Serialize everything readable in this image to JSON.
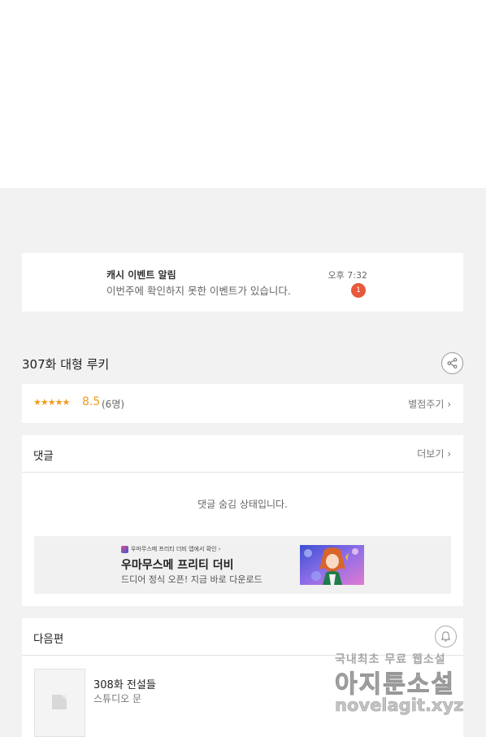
{
  "notification": {
    "title": "캐시 이벤트 알림",
    "body": "이번주에 확인하지 못한 이벤트가 있습니다.",
    "time": "오후 7:32",
    "badge": "1"
  },
  "episode": {
    "title": "307화 대형 루키"
  },
  "rating": {
    "stars": "★★★★★",
    "score": "8.5",
    "count": "(6명)",
    "rate_link": "별점주기 ›"
  },
  "comments": {
    "title": "댓글",
    "more": "더보기 ›",
    "hidden_message": "댓글 숨김 상태입니다."
  },
  "ad": {
    "source": "우마무스메 프리티 더비 앱에서 확인 ›",
    "title": "우마무스메 프리티 더비",
    "description": "드디어 정식 오픈! 지금 바로 다운로드"
  },
  "next_episode": {
    "section_title": "다음편",
    "title": "308화 전설들",
    "author": "스튜디오 문"
  },
  "watermark": {
    "line1": "국내최초 무료 웹소설",
    "line2": "아지툰소설",
    "line3": "novelagit.xyz"
  },
  "colors": {
    "accent": "#f29a1e",
    "badge": "#e8583c",
    "background": "#f2f2f2"
  }
}
